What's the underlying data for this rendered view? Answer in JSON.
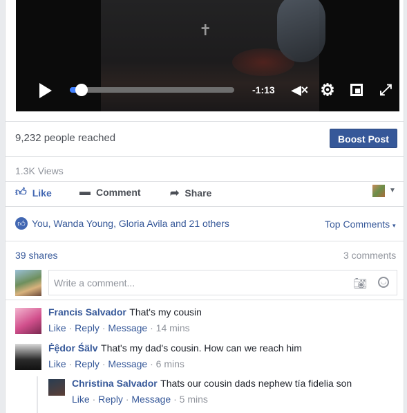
{
  "video": {
    "time_remaining": "-1:13",
    "progress": 0.07,
    "mute_glyph": "◀×",
    "fullscreen_glyph": "⤢"
  },
  "post": {
    "reached_text": "9,232 people reached",
    "boost_label": "Boost Post",
    "views_text": "1.3K Views"
  },
  "actions": {
    "like_label": "Like",
    "comment_label": "Comment",
    "share_label": "Share"
  },
  "reactions": {
    "summary": "You, Wanda Young, Gloria Avila and 21 others",
    "top_comments_label": "Top Comments",
    "shares_text": "39 shares",
    "comments_count_text": "3 comments"
  },
  "composer": {
    "placeholder": "Write a comment..."
  },
  "comments": [
    {
      "author": "Francis Salvador",
      "text": "That's my cousin",
      "like": "Like",
      "reply": "Reply",
      "message": "Message",
      "time": "14 mins"
    },
    {
      "author": "Ḟệdor Śälv",
      "text": "That's my dad's cousin. How can we reach him",
      "like": "Like",
      "reply": "Reply",
      "message": "Message",
      "time": "6 mins"
    },
    {
      "author": "Christina Salvador",
      "text": "Thats our cousin dads nephew tía fidelia son",
      "like": "Like",
      "reply": "Reply",
      "message": "Message",
      "time": "5 mins"
    }
  ],
  "colors": {
    "accent": "#4267b2",
    "link": "#365899",
    "boost_button": "#365899",
    "muted_text": "#90949c"
  }
}
